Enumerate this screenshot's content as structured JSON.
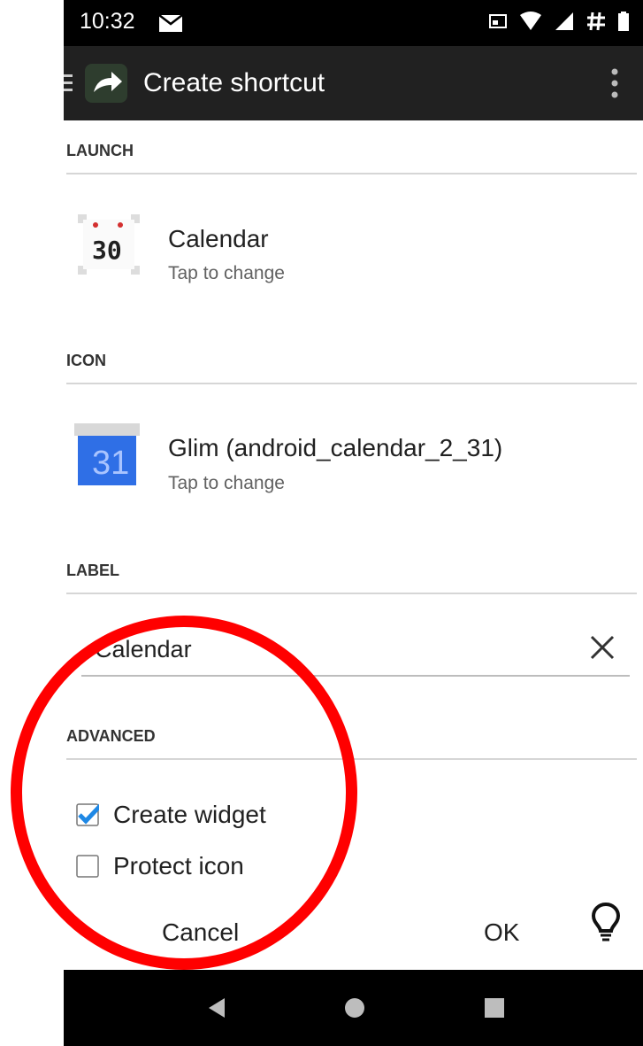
{
  "status_bar": {
    "time": "10:32"
  },
  "app_bar": {
    "title": "Create shortcut"
  },
  "sections": {
    "launch": "LAUNCH",
    "icon": "ICON",
    "label": "LABEL",
    "advanced": "ADVANCED"
  },
  "launch_item": {
    "title": "Calendar",
    "subtitle": "Tap to change",
    "icon_text": "30"
  },
  "icon_item": {
    "title": "Glim (android_calendar_2_31)",
    "subtitle": "Tap to change",
    "icon_text": "31"
  },
  "label_field": {
    "value": "Calendar"
  },
  "options": [
    {
      "label": "Create widget",
      "checked": true
    },
    {
      "label": "Protect icon",
      "checked": false
    }
  ],
  "buttons": {
    "cancel": "Cancel",
    "ok": "OK"
  },
  "colors": {
    "accent": "#1e88e5",
    "annotation": "#ff0000",
    "app_bar": "#212121"
  },
  "icons": [
    "mail-icon",
    "cast-icon",
    "wifi-icon",
    "signal-icon",
    "hash-icon",
    "battery-icon",
    "menu-icon",
    "arrow-icon",
    "overflow-icon",
    "clear-icon",
    "lightbulb-icon",
    "back-icon",
    "home-icon",
    "recents-icon"
  ]
}
